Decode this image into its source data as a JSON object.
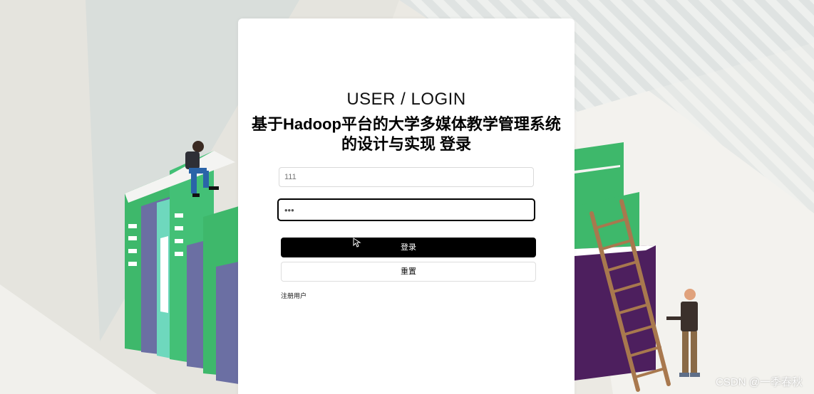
{
  "login": {
    "heading_en": "USER / LOGIN",
    "heading_cn": "基于Hadoop平台的大学多媒体教学管理系统的设计与实现 登录",
    "username_value": "111",
    "password_value": "•••",
    "login_button": "登录",
    "reset_button": "重置",
    "register_link": "注册用户"
  },
  "watermark": "CSDN @一季春秋",
  "colors": {
    "card": "#ffffff",
    "primary_button": "#000000",
    "book_green": "#3eb86b",
    "book_purple": "#6b6fa3",
    "book_dark_purple": "#4d1f5e",
    "ladder": "#a8784e"
  },
  "icons": {
    "background": "books-and-ladder-illustration",
    "cursor": "mouse-pointer-icon"
  }
}
